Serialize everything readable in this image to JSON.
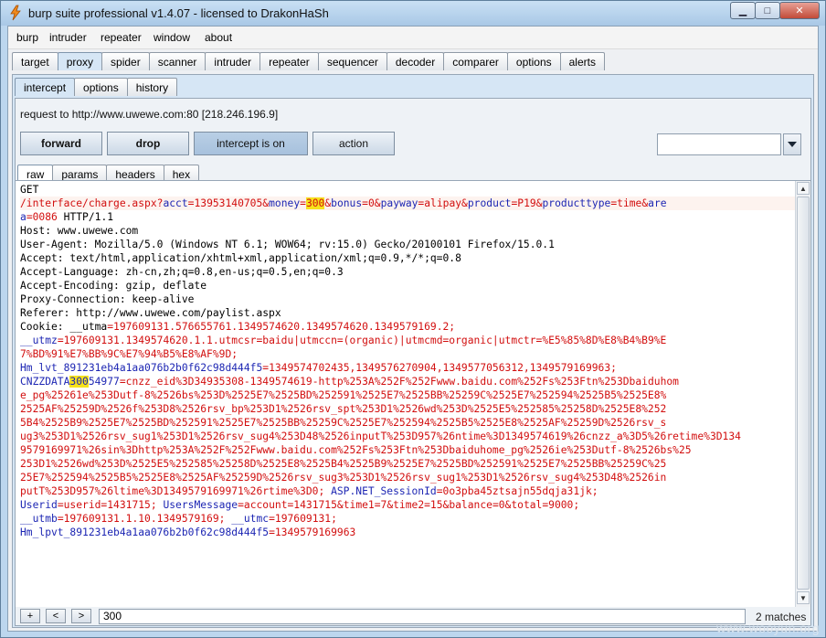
{
  "window": {
    "title": "burp suite professional v1.4.07 - licensed to DrakonHaSh",
    "minimize": "▁",
    "maximize": "□",
    "close": "✕"
  },
  "menu": [
    "burp",
    "intruder",
    "repeater",
    "window",
    "about"
  ],
  "main_tabs": [
    "target",
    "proxy",
    "spider",
    "scanner",
    "intruder",
    "repeater",
    "sequencer",
    "decoder",
    "comparer",
    "options",
    "alerts"
  ],
  "main_tab_active": "proxy",
  "proxy_tabs": [
    "intercept",
    "options",
    "history"
  ],
  "proxy_tab_active": "intercept",
  "request_info": "request to http://www.uwewe.com:80  [218.246.196.9]",
  "buttons": {
    "forward": "forward",
    "drop": "drop",
    "intercept": "intercept is on",
    "action": "action"
  },
  "combo_value": "",
  "view_tabs": [
    "raw",
    "params",
    "headers",
    "hex"
  ],
  "view_tab_active": "raw",
  "request_lines": {
    "l1": "GET",
    "l2_path": "/interface/charge.aspx?",
    "l2_acct_k": "acct",
    "l2_eq": "=",
    "l2_acct_v": "13953140705",
    "l2_amp": "&",
    "l2_money_k": "money",
    "l2_money_v": "300",
    "l2_bonus_k": "bonus",
    "l2_bonus_v": "0",
    "l2_payway_k": "payway",
    "l2_payway_v": "alipay",
    "l2_product_k": "product",
    "l2_product_v": "P19",
    "l2_ptype_k": "producttype",
    "l2_ptype_v": "time",
    "l2_are": "are",
    "l3_a": "a",
    "l3_v": "0086",
    "l3_rest": " HTTP/1.1",
    "l4": "Host: www.uwewe.com",
    "l5": "User-Agent: Mozilla/5.0 (Windows NT 6.1; WOW64; rv:15.0) Gecko/20100101 Firefox/15.0.1",
    "l6": "Accept: text/html,application/xhtml+xml,application/xml;q=0.9,*/*;q=0.8",
    "l7": "Accept-Language: zh-cn,zh;q=0.8,en-us;q=0.5,en;q=0.3",
    "l8": "Accept-Encoding: gzip, deflate",
    "l9": "Proxy-Connection: keep-alive",
    "l10": "Referer: http://www.uwewe.com/paylist.aspx",
    "l11_k": "Cookie: __utma",
    "l11_v": "197609131.576655761.1349574620.1349574620.1349579169.2;",
    "l12_k": "__utmz",
    "l12_v": "197609131.1349574620.1.1.utmcsr=baidu|utmccn=(organic)|utmcmd=organic|utmctr=%E5%85%8D%E8%B4%B9%E",
    "l13_v": "7%BD%91%E7%BB%9C%E7%94%B5%E8%AF%9D;",
    "l14_k": "Hm_lvt_891231eb4a1aa076b2b0f62c98d444f5",
    "l14_v": "1349574702435,1349576270904,1349577056312,1349579169963;",
    "l15_k1": "CNZZDATA",
    "l15_k2": "300",
    "l15_k3": "54977",
    "l15_v": "cnzz_eid%3D34935308-1349574619-http%253A%252F%252Fwww.baidu.com%252Fs%253Ftn%253Dbaiduhom",
    "l16": "e_pg%25261e%253Dutf-8%2526bs%253D%2525E7%2525BD%252591%2525E7%2525BB%25259C%2525E7%252594%2525B5%2525E8%",
    "l17": "2525AF%25259D%2526f%253D8%2526rsv_bp%253D1%2526rsv_spt%253D1%2526wd%253D%2525E5%252585%25258D%2525E8%252",
    "l18": "5B4%2525B9%2525E7%2525BD%252591%2525E7%2525BB%25259C%2525E7%252594%2525B5%2525E8%2525AF%25259D%2526rsv_s",
    "l19": "ug3%253D1%2526rsv_sug1%253D1%2526rsv_sug4%253D48%2526inputT%253D957%26ntime%3D1349574619%26cnzz_a%3D5%26retime%3D134",
    "l20": "9579169971%26sin%3Dhttp%253A%252F%252Fwww.baidu.com%252Fs%253Ftn%253Dbaiduhome_pg%2526ie%253Dutf-8%2526bs%25",
    "l21": "253D1%2526wd%253D%2525E5%252585%25258D%2525E8%2525B4%2525B9%2525E7%2525BD%252591%2525E7%2525BB%25259C%25",
    "l22": "25E7%252594%2525B5%2525E8%2525AF%25259D%2526rsv_sug3%253D1%2526rsv_sug1%253D1%2526rsv_sug4%253D48%2526in",
    "l23_v": "putT%253D957%26ltime%3D1349579169971%26rtime%3D0;",
    "l23_k2": " ASP.NET_SessionId",
    "l23_v2": "0o3pba45ztsajn55dqja31jk;",
    "l24_k": "Userid",
    "l24_v": "userid=1431715;",
    "l24_k2": " UsersMessage",
    "l24_v2": "account=1431715&time1=7&time2=15&balance=0&total=9000;",
    "l25_k": "__utmb",
    "l25_v": "197609131.1.10.1349579169;",
    "l25_k2": " __utmc",
    "l25_v2": "197609131;",
    "l26_k": "Hm_lpvt_891231eb4a1aa076b2b0f62c98d444f5",
    "l26_v": "1349579169963"
  },
  "search": {
    "prev_label": "+",
    "back_label": "<",
    "next_label": ">",
    "value": "300",
    "matches": "2 matches"
  },
  "watermark": "www.wooyun.org"
}
